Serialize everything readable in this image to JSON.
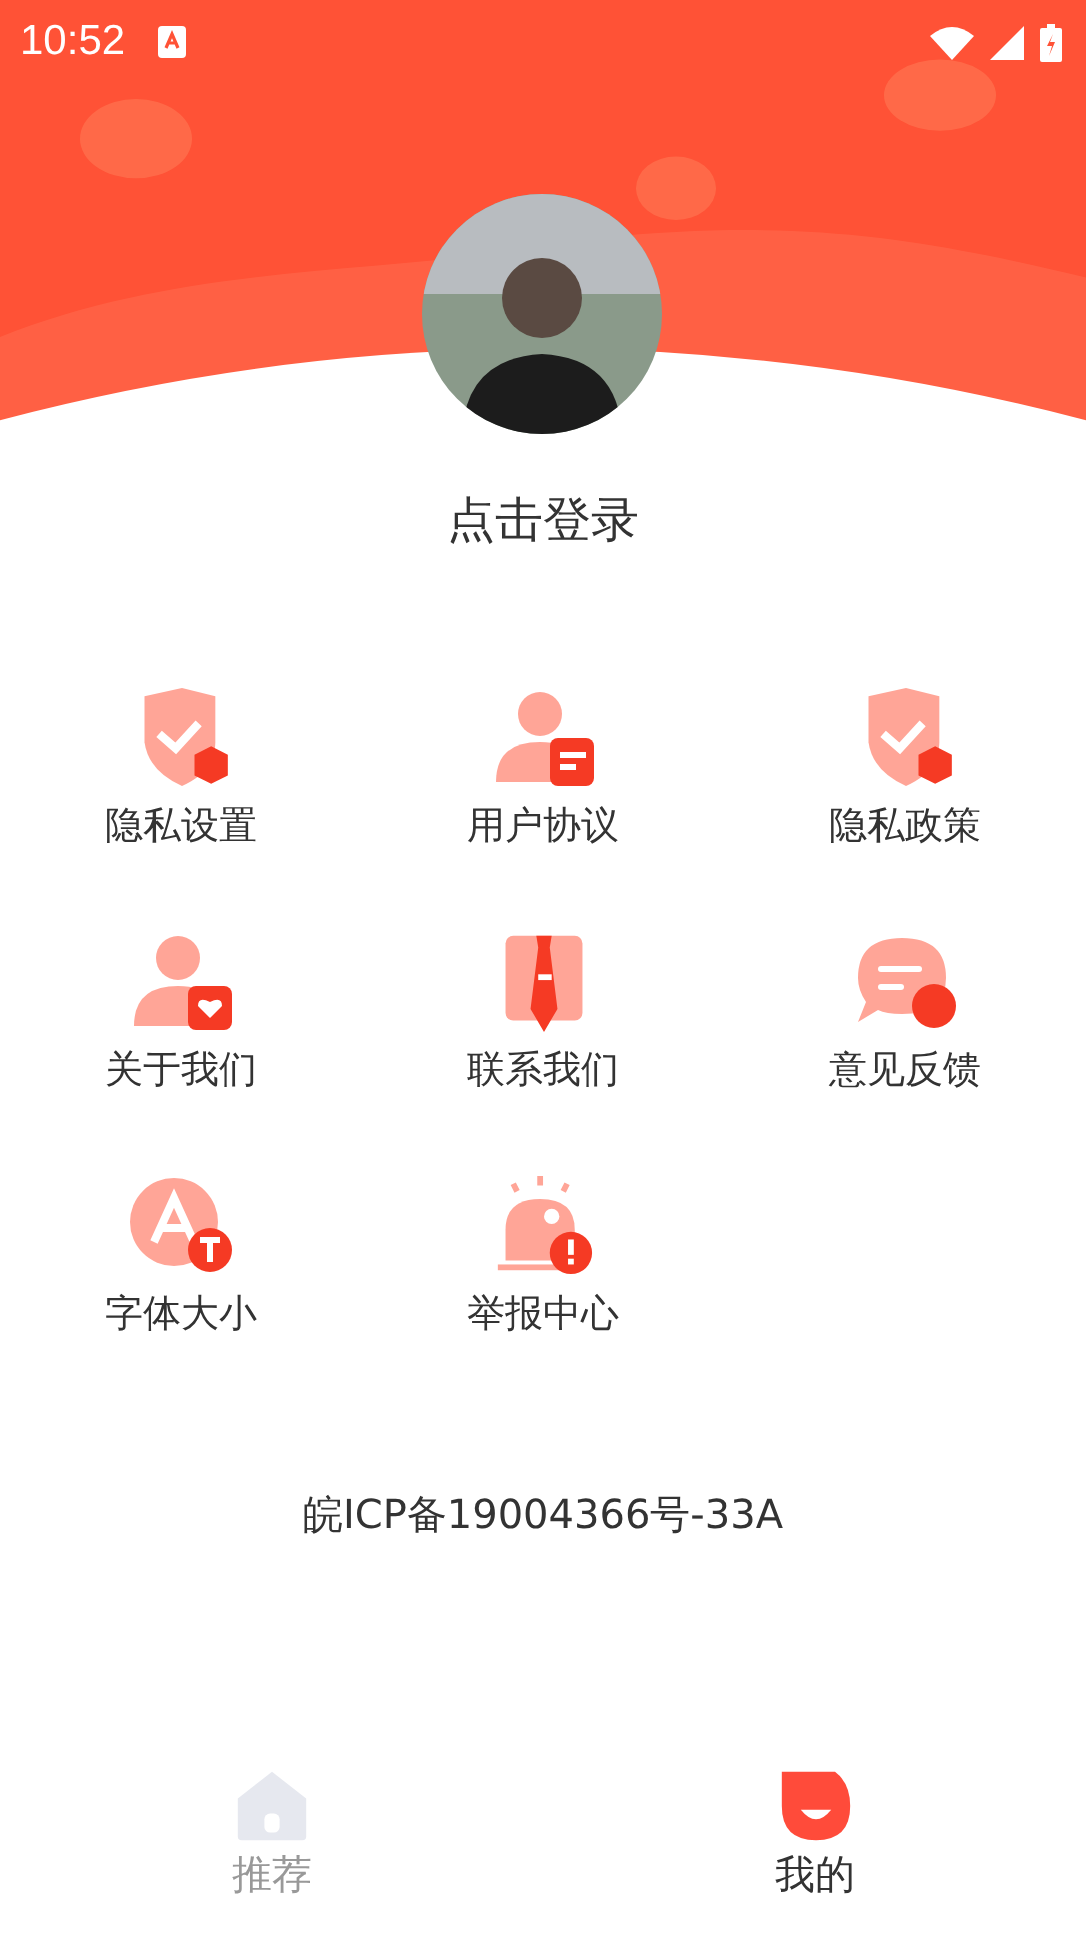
{
  "status_bar": {
    "time": "10:52"
  },
  "profile": {
    "login_label": "点击登录"
  },
  "menu": [
    {
      "label": "隐私设置"
    },
    {
      "label": "用户协议"
    },
    {
      "label": "隐私政策"
    },
    {
      "label": "关于我们"
    },
    {
      "label": "联系我们"
    },
    {
      "label": "意见反馈"
    },
    {
      "label": "字体大小"
    },
    {
      "label": "举报中心"
    }
  ],
  "footer": {
    "icp": "皖ICP备19004366号-33A"
  },
  "tabs": [
    {
      "label": "推荐",
      "selected": false
    },
    {
      "label": "我的",
      "selected": true
    }
  ]
}
